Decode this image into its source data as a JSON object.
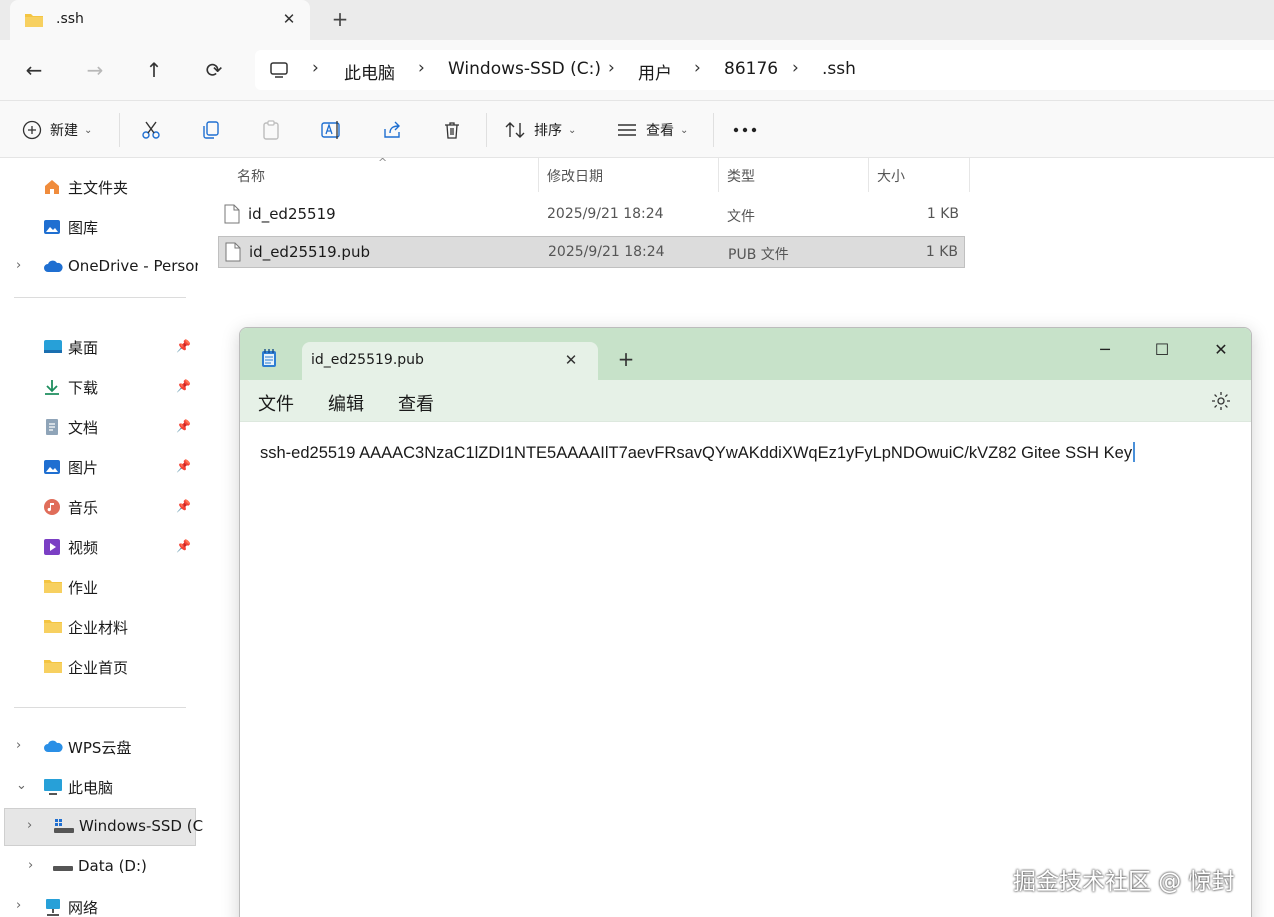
{
  "explorer": {
    "tab_title": ".ssh",
    "breadcrumb": [
      "此电脑",
      "Windows-SSD (C:)",
      "用户",
      "86176",
      ".ssh"
    ],
    "command_bar": {
      "new_label": "新建",
      "sort_label": "排序",
      "view_label": "查看"
    },
    "sidebar": {
      "items": [
        {
          "label": "主文件夹"
        },
        {
          "label": "图库"
        },
        {
          "label": "OneDrive - Persor"
        },
        {
          "label": "桌面"
        },
        {
          "label": "下载"
        },
        {
          "label": "文档"
        },
        {
          "label": "图片"
        },
        {
          "label": "音乐"
        },
        {
          "label": "视频"
        },
        {
          "label": "作业"
        },
        {
          "label": "企业材料"
        },
        {
          "label": "企业首页"
        },
        {
          "label": "WPS云盘"
        },
        {
          "label": "此电脑"
        },
        {
          "label": "Windows-SSD (C"
        },
        {
          "label": "Data (D:)"
        },
        {
          "label": "网络"
        }
      ]
    },
    "columns": {
      "name": "名称",
      "modified": "修改日期",
      "type": "类型",
      "size": "大小"
    },
    "files": [
      {
        "name": "id_ed25519",
        "modified": "2025/9/21 18:24",
        "type": "文件",
        "size": "1 KB"
      },
      {
        "name": "id_ed25519.pub",
        "modified": "2025/9/21 18:24",
        "type": "PUB 文件",
        "size": "1 KB"
      }
    ]
  },
  "notepad": {
    "tab_title": "id_ed25519.pub",
    "menu": {
      "file": "文件",
      "edit": "编辑",
      "view": "查看"
    },
    "content": "ssh-ed25519 AAAAC3NzaC1lZDI1NTE5AAAAIlT7aevFRsavQYwAKddiXWqEz1yFyLpNDOwuiC/kVZ82 Gitee SSH Key"
  },
  "watermark": "掘金技术社区 @ 惊封",
  "colors": {
    "notepad_titlebar": "#c7e2c9",
    "notepad_menubar": "#e6f1e7",
    "folder_yellow": "#f4c542",
    "accent_blue": "#1f6fd1"
  }
}
